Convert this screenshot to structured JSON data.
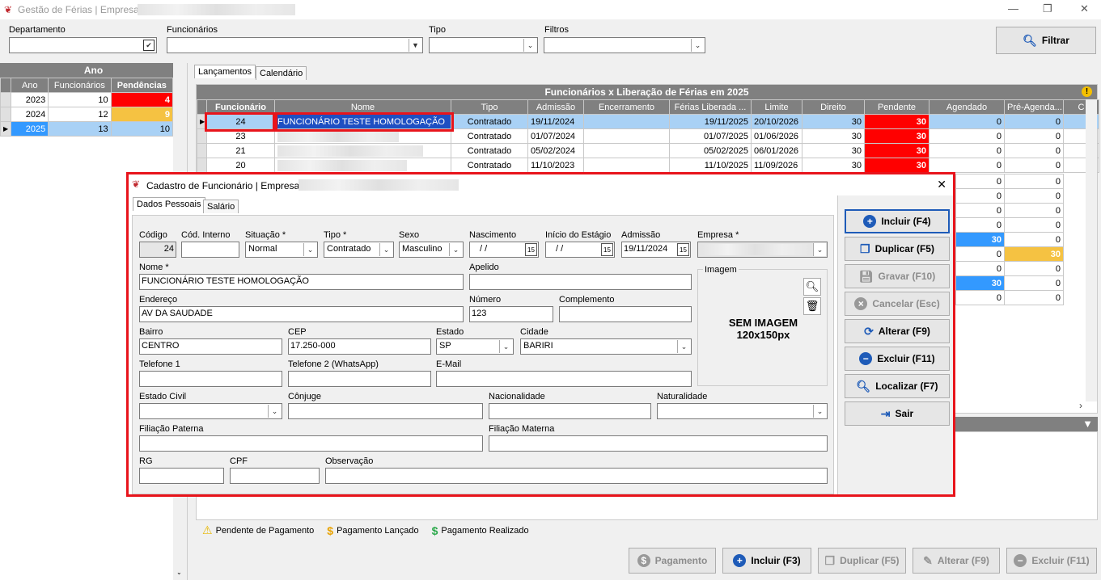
{
  "window": {
    "title": "Gestão de Férias | Empresa:",
    "min": "—",
    "max": "❐",
    "close": "✕"
  },
  "filters": {
    "departamento": "Departamento",
    "funcionarios": "Funcionários",
    "tipo": "Tipo",
    "filtros": "Filtros",
    "filtrar": "Filtrar",
    "check": "✔"
  },
  "ano_panel": {
    "title": "Ano",
    "headers": [
      "Ano",
      "Funcionários",
      "Pendências"
    ],
    "rows": [
      {
        "ano": "2023",
        "func": "10",
        "pend": "4"
      },
      {
        "ano": "2024",
        "func": "12",
        "pend": "9"
      },
      {
        "ano": "2025",
        "func": "13",
        "pend": "10"
      }
    ]
  },
  "tabs": {
    "lancamentos": "Lançamentos",
    "calendario": "Calendário"
  },
  "grid": {
    "title": "Funcionários x Liberação de Férias em 2025",
    "headers": [
      "Funcionário",
      "Nome",
      "Tipo",
      "Admissão",
      "Encerramento",
      "Férias Liberada ...",
      "Limite",
      "Direito",
      "Pendente",
      "Agendado",
      "Pré-Agenda...",
      "C"
    ],
    "rows": [
      {
        "func": "24",
        "nome": "FUNCIONÁRIO TESTE HOMOLOGAÇÃO",
        "tipo": "Contratado",
        "adm": "19/11/2024",
        "enc": "",
        "lib": "19/11/2025",
        "lim": "20/10/2026",
        "dir": "30",
        "pend": "30",
        "ag": "0",
        "pre": "0"
      },
      {
        "func": "23",
        "nome": "",
        "tipo": "Contratado",
        "adm": "01/07/2024",
        "enc": "",
        "lib": "01/07/2025",
        "lim": "01/06/2026",
        "dir": "30",
        "pend": "30",
        "ag": "0",
        "pre": "0"
      },
      {
        "func": "21",
        "nome": "",
        "tipo": "Contratado",
        "adm": "05/02/2024",
        "enc": "",
        "lib": "05/02/2025",
        "lim": "06/01/2026",
        "dir": "30",
        "pend": "30",
        "ag": "0",
        "pre": "0"
      },
      {
        "func": "20",
        "nome": "",
        "tipo": "Contratado",
        "adm": "11/10/2023",
        "enc": "",
        "lib": "11/10/2025",
        "lim": "11/09/2026",
        "dir": "30",
        "pend": "30",
        "ag": "0",
        "pre": "0"
      }
    ],
    "partial_rows": [
      {
        "ag": "0",
        "pre": "0"
      },
      {
        "ag": "0",
        "pre": "0"
      },
      {
        "ag": "0",
        "pre": "0"
      },
      {
        "ag": "0",
        "pre": "0"
      },
      {
        "ag": "30",
        "pre": "0"
      },
      {
        "ag": "0",
        "pre": "30"
      },
      {
        "ag": "0",
        "pre": "0"
      },
      {
        "ag": "30",
        "pre": "0"
      },
      {
        "ag": "0",
        "pre": "0"
      }
    ]
  },
  "legend": {
    "pendente": "Pendente de Pagamento",
    "lancado": "Pagamento Lançado",
    "realizado": "Pagamento Realizado"
  },
  "bottom_buttons": {
    "pagamento": "Pagamento",
    "incluir": "Incluir (F3)",
    "duplicar": "Duplicar (F5)",
    "alterar": "Alterar (F9)",
    "excluir": "Excluir (F11)"
  },
  "dialog": {
    "title": "Cadastro de Funcionário | Empresa:",
    "tabs": {
      "dados": "Dados Pessoais",
      "salario": "Salário"
    },
    "labels": {
      "codigo": "Código",
      "cod_interno": "Cód. Interno",
      "situacao": "Situação *",
      "tipo": "Tipo *",
      "sexo": "Sexo",
      "nascimento": "Nascimento",
      "inicio_estagio": "Início do Estágio",
      "admissao": "Admissão",
      "empresa": "Empresa *",
      "nome": "Nome *",
      "apelido": "Apelido",
      "imagem": "Imagem",
      "endereco": "Endereço",
      "numero": "Número",
      "complemento": "Complemento",
      "bairro": "Bairro",
      "cep": "CEP",
      "estado": "Estado",
      "cidade": "Cidade",
      "telefone1": "Telefone 1",
      "telefone2": "Telefone 2 (WhatsApp)",
      "email": "E-Mail",
      "estado_civil": "Estado Civil",
      "conjuge": "Cônjuge",
      "nacionalidade": "Nacionalidade",
      "naturalidade": "Naturalidade",
      "filiacao_paterna": "Filiação Paterna",
      "filiacao_materna": "Filiação Materna",
      "rg": "RG",
      "cpf": "CPF",
      "observacao": "Observação"
    },
    "values": {
      "codigo": "24",
      "situacao": "Normal",
      "tipo": "Contratado",
      "sexo": "Masculino",
      "nascimento": "/ /",
      "inicio_estagio": "/ /",
      "admissao": "19/11/2024",
      "nome": "FUNCIONÁRIO TESTE HOMOLOGAÇÃO",
      "endereco": "AV DA SAUDADE",
      "numero": "123",
      "bairro": "CENTRO",
      "cep": "17.250-000",
      "estado": "SP",
      "cidade": "BARIRI"
    },
    "image_placeholder": {
      "line1": "SEM IMAGEM",
      "line2": "120x150px"
    },
    "cal_icon": "15",
    "buttons": {
      "incluir": "Incluir (F4)",
      "duplicar": "Duplicar (F5)",
      "gravar": "Gravar (F10)",
      "cancelar": "Cancelar (Esc)",
      "alterar": "Alterar (F9)",
      "excluir": "Excluir (F11)",
      "localizar": "Localizar (F7)",
      "sair": "Sair"
    },
    "close": "✕"
  }
}
